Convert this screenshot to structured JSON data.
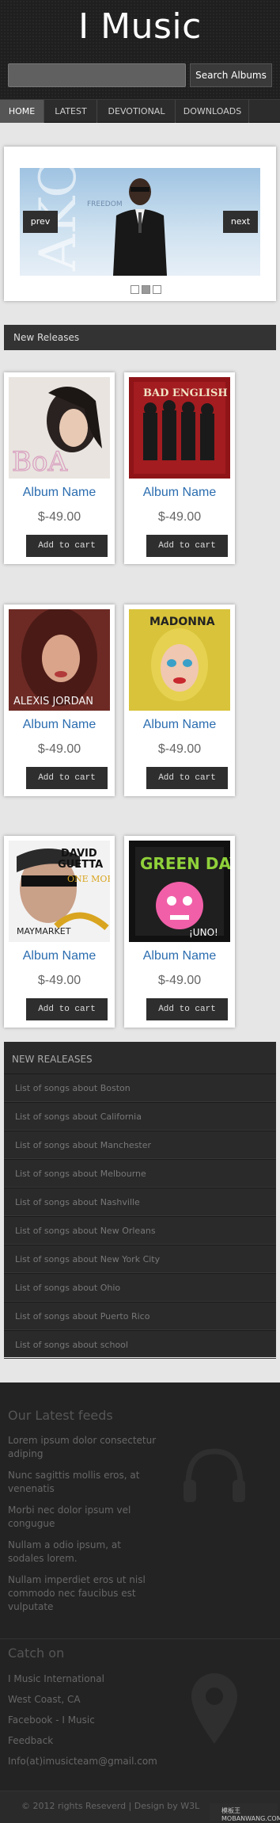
{
  "header": {
    "title": "I Music",
    "search_placeholder": "",
    "search_button": "Search Albums"
  },
  "nav": {
    "items": [
      "HOME",
      "LATEST",
      "DEVOTIONAL",
      "DOWNLOADS"
    ]
  },
  "slider": {
    "prev": "prev",
    "next": "next",
    "dot_count": 3,
    "active_dot": 2
  },
  "new_releases": {
    "title": "New Releases",
    "albums": [
      {
        "name": "Album Name",
        "price": "$-49.00",
        "button": "Add to cart"
      },
      {
        "name": "Album Name",
        "price": "$-49.00",
        "button": "Add to cart"
      },
      {
        "name": "Album Name",
        "price": "$-49.00",
        "button": "Add to cart"
      },
      {
        "name": "Album Name",
        "price": "$-49.00",
        "button": "Add to cart"
      },
      {
        "name": "Album Name",
        "price": "$-49.00",
        "button": "Add to cart"
      },
      {
        "name": "Album Name",
        "price": "$-49.00",
        "button": "Add to cart"
      }
    ]
  },
  "songs": {
    "title": "NEW REALEASES",
    "items": [
      "List of songs about Boston",
      "List of songs about California",
      "List of songs about Manchester",
      "List of songs about Melbourne",
      "List of songs about Nashville",
      "List of songs about New Orleans",
      "List of songs about New York City",
      "List of songs about Ohio",
      "List of songs about Puerto Rico",
      "List of songs about school"
    ]
  },
  "footer": {
    "feeds_title": "Our Latest feeds",
    "feeds": [
      "Lorem ipsum dolor consectetur adiping",
      "Nunc sagittis mollis eros, at venenatis",
      "Morbi nec dolor ipsum vel congugue",
      "Nullam a odio ipsum, at sodales lorem.",
      "Nullam imperdiet eros ut nisl commodo nec faucibus est vulputate"
    ],
    "catch_title": "Catch on",
    "catch": [
      "I Music International",
      "West Coast, CA",
      "Facebook - I Music",
      "Feedback",
      "Info(at)imusicteam@gmail.com"
    ],
    "copyright": "© 2012 rights Reseverd | Design by W3L",
    "badge": "模板王  MOBANWANG.COM"
  }
}
